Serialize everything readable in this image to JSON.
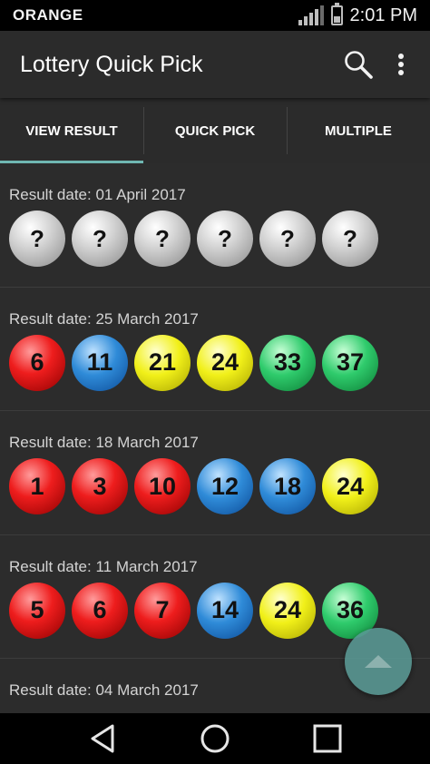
{
  "status_bar": {
    "carrier": "ORANGE",
    "time": "2:01 PM"
  },
  "app_bar": {
    "title": "Lottery Quick Pick",
    "search_icon": "search-icon",
    "menu_icon": "more-vert-icon"
  },
  "tabs": [
    {
      "label": "VIEW RESULT",
      "selected": true
    },
    {
      "label": "QUICK PICK",
      "selected": false
    },
    {
      "label": "MULTIPLE",
      "selected": false
    }
  ],
  "colors": {
    "accent": "#6fb7b2",
    "red": "#ee1d1d",
    "blue": "#2f8bd8",
    "yellow": "#f1f019",
    "green": "#2fcb6c",
    "gray": "#c8c8c8"
  },
  "results": [
    {
      "date": "Result date: 01 April 2017",
      "balls": [
        {
          "label": "?",
          "color": "gray"
        },
        {
          "label": "?",
          "color": "gray"
        },
        {
          "label": "?",
          "color": "gray"
        },
        {
          "label": "?",
          "color": "gray"
        },
        {
          "label": "?",
          "color": "gray"
        },
        {
          "label": "?",
          "color": "gray"
        }
      ]
    },
    {
      "date": "Result date: 25 March 2017",
      "balls": [
        {
          "label": "6",
          "color": "red"
        },
        {
          "label": "11",
          "color": "blue"
        },
        {
          "label": "21",
          "color": "yellow"
        },
        {
          "label": "24",
          "color": "yellow"
        },
        {
          "label": "33",
          "color": "green"
        },
        {
          "label": "37",
          "color": "green"
        }
      ]
    },
    {
      "date": "Result date: 18 March 2017",
      "balls": [
        {
          "label": "1",
          "color": "red"
        },
        {
          "label": "3",
          "color": "red"
        },
        {
          "label": "10",
          "color": "red"
        },
        {
          "label": "12",
          "color": "blue"
        },
        {
          "label": "18",
          "color": "blue"
        },
        {
          "label": "24",
          "color": "yellow"
        }
      ]
    },
    {
      "date": "Result date: 11 March 2017",
      "balls": [
        {
          "label": "5",
          "color": "red"
        },
        {
          "label": "6",
          "color": "red"
        },
        {
          "label": "7",
          "color": "red"
        },
        {
          "label": "14",
          "color": "blue"
        },
        {
          "label": "24",
          "color": "yellow"
        },
        {
          "label": "36",
          "color": "green"
        }
      ]
    },
    {
      "date": "Result date: 04 March 2017",
      "balls": []
    }
  ],
  "fab": {
    "icon": "caret-up-icon"
  },
  "nav_bar": {
    "back_icon": "back-icon",
    "home_icon": "home-icon",
    "recents_icon": "recents-icon"
  }
}
